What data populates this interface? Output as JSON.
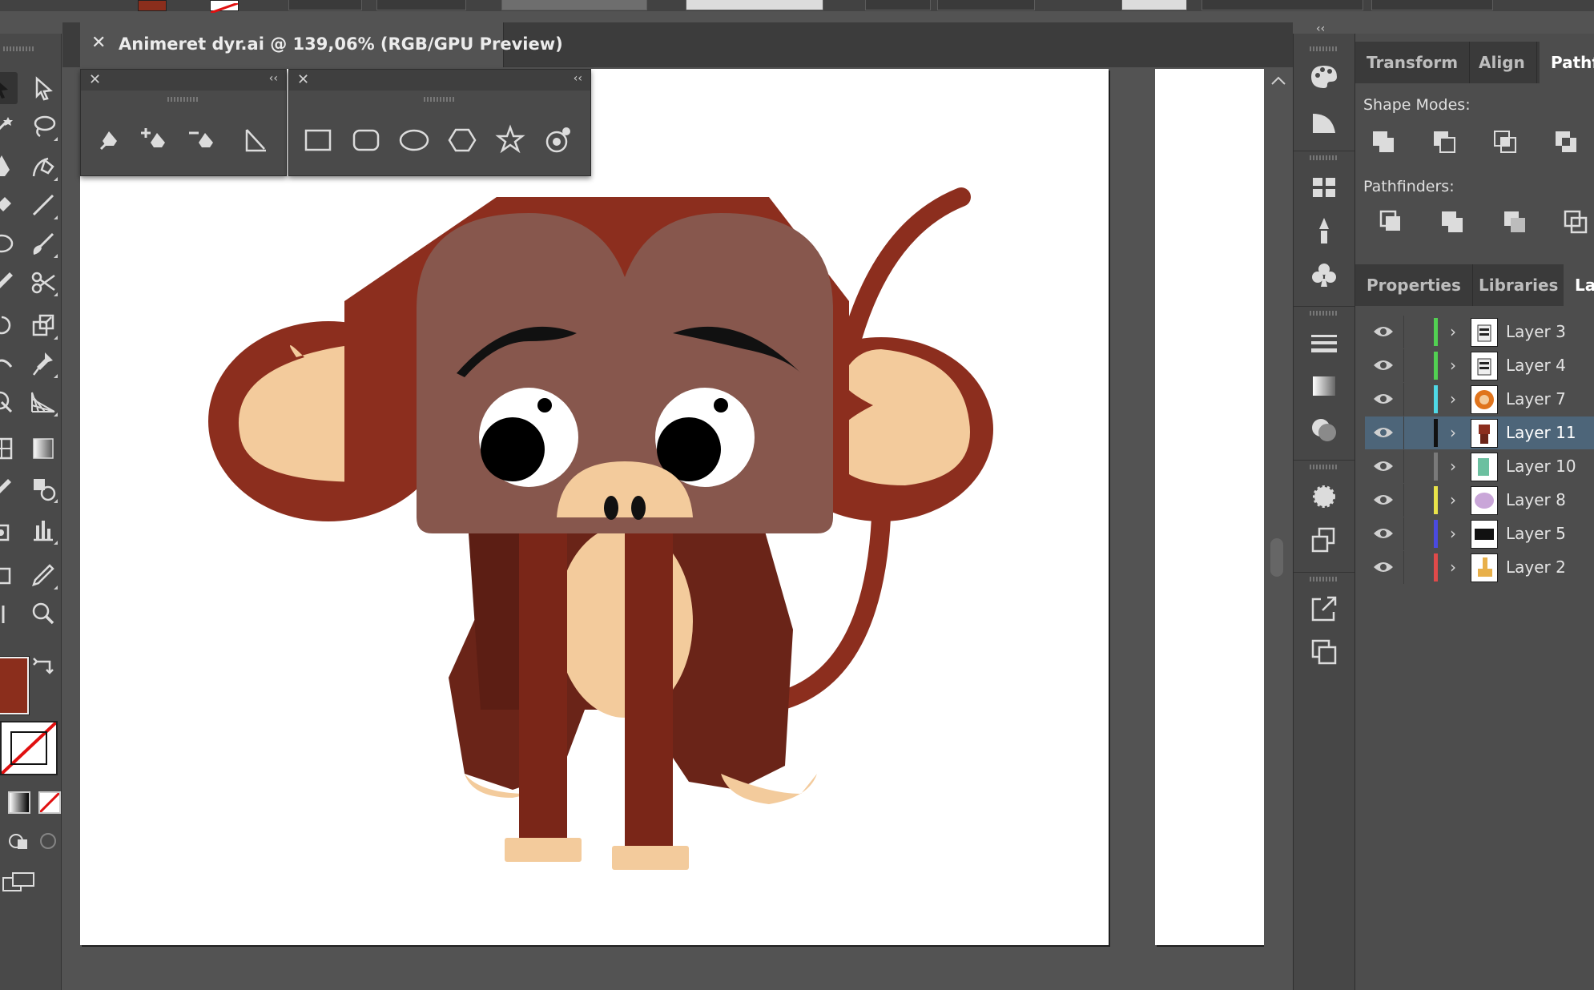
{
  "document": {
    "tab_title": "Animeret dyr.ai @ 139,06% (RGB/GPU Preview)"
  },
  "colors": {
    "fill": "#8b2e1c",
    "stroke": "none",
    "selected_layer_bg": "#4d6579",
    "app_bg": "#535353"
  },
  "tool_icons": [
    "selection-tool-icon",
    "direct-selection-tool-icon",
    "magic-wand-icon",
    "lasso-icon",
    "pen-tool-icon",
    "curvature-tool-icon",
    "type-tool-icon",
    "line-segment-tool-icon",
    "ellipse-tool-icon",
    "paintbrush-tool-icon",
    "pencil-tool-icon",
    "scissors-tool-icon",
    "rotate-tool-icon",
    "scale-tool-icon",
    "width-tool-icon",
    "puppet-warp-icon",
    "shape-builder-icon",
    "perspective-grid-icon",
    "mesh-tool-icon",
    "gradient-tool-icon",
    "eyedropper-tool-icon",
    "blend-tool-icon",
    "symbol-sprayer-icon",
    "column-graph-icon",
    "artboard-tool-icon",
    "slice-tool-icon",
    "hand-tool-icon",
    "zoom-tool-icon"
  ],
  "pen_toolbar": {
    "icons": [
      "pen-tool-icon",
      "add-anchor-point-icon",
      "delete-anchor-point-icon",
      "anchor-point-tool-icon"
    ]
  },
  "shape_toolbar": {
    "icons": [
      "rectangle-tool-icon",
      "rounded-rectangle-tool-icon",
      "ellipse-tool-icon",
      "polygon-tool-icon",
      "star-tool-icon",
      "flare-tool-icon"
    ]
  },
  "right_icons": [
    "color-palette-icon",
    "color-guide-icon",
    "swatches-icon",
    "brushes-icon",
    "symbols-icon",
    "stroke-icon",
    "gradient-icon",
    "transparency-icon",
    "appearance-icon",
    "graphic-styles-icon",
    "export-icon",
    "artboards-icon"
  ],
  "pathfinder_panel": {
    "tabs": [
      "Transform",
      "Align",
      "Pathfi"
    ],
    "active_tab": "Pathfi",
    "shape_modes_label": "Shape Modes:",
    "pathfinders_label": "Pathfinders:"
  },
  "layers_panel": {
    "tabs": [
      "Properties",
      "Libraries",
      "La"
    ],
    "active_tab": "La",
    "layers": [
      {
        "name": "Layer 3",
        "color": "#52d052",
        "thumb": "zebra",
        "selected": false
      },
      {
        "name": "Layer 4",
        "color": "#52d052",
        "thumb": "zebra",
        "selected": false
      },
      {
        "name": "Layer 7",
        "color": "#4fd8e6",
        "thumb": "lion",
        "selected": false
      },
      {
        "name": "Layer 11",
        "color": "#111111",
        "thumb": "monkey",
        "selected": true
      },
      {
        "name": "Layer 10",
        "color": "#7a7a7a",
        "thumb": "crocodile",
        "selected": false
      },
      {
        "name": "Layer 8",
        "color": "#e9e34a",
        "thumb": "elephant",
        "selected": false
      },
      {
        "name": "Layer 5",
        "color": "#4a4ae0",
        "thumb": "silhouette",
        "selected": false
      },
      {
        "name": "Layer 2",
        "color": "#e04a4a",
        "thumb": "giraffe",
        "selected": false
      }
    ]
  }
}
